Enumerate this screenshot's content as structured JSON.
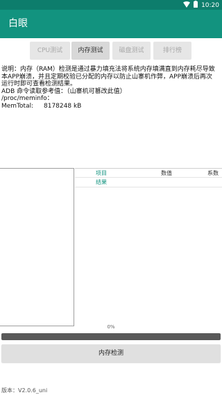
{
  "status_bar": {
    "time": "10:20",
    "wifi_icon": "wifi-icon",
    "battery_icon": "battery-icon"
  },
  "app_bar": {
    "title": "白眼"
  },
  "tabs": [
    {
      "label": "CPU测试",
      "state": "disabled"
    },
    {
      "label": "内存测试",
      "state": "selected"
    },
    {
      "label": "磁盘测试",
      "state": "disabled"
    },
    {
      "label": "排行榜",
      "state": "disabled"
    }
  ],
  "description": {
    "lines": [
      "说明：内存（RAM）检测是通过暴力填充法将系统内存填满直到内存耗尽导致",
      "本APP崩溃，并且定期校验已分配的内存以防止山寨机作弊，APP崩溃后再次",
      "运行时即可查看检测结果。",
      "ADB 命令读取参考值：（山寨机可篡改此值）",
      "/proc/meminfo："
    ],
    "mem_label": "MemTotal:",
    "mem_value": "8178248 kB"
  },
  "table": {
    "headers": [
      "项目",
      "数值",
      "系数"
    ],
    "rows": [
      {
        "item": "结果"
      }
    ]
  },
  "progress": {
    "label": "0%",
    "value": 0
  },
  "primary_button": {
    "label": "内存检测"
  },
  "version": "版本：V2.0.6_uni",
  "colors": {
    "primary": "#12937f",
    "primary_dark": "#0d7d6c",
    "accent_text": "#12937f"
  }
}
